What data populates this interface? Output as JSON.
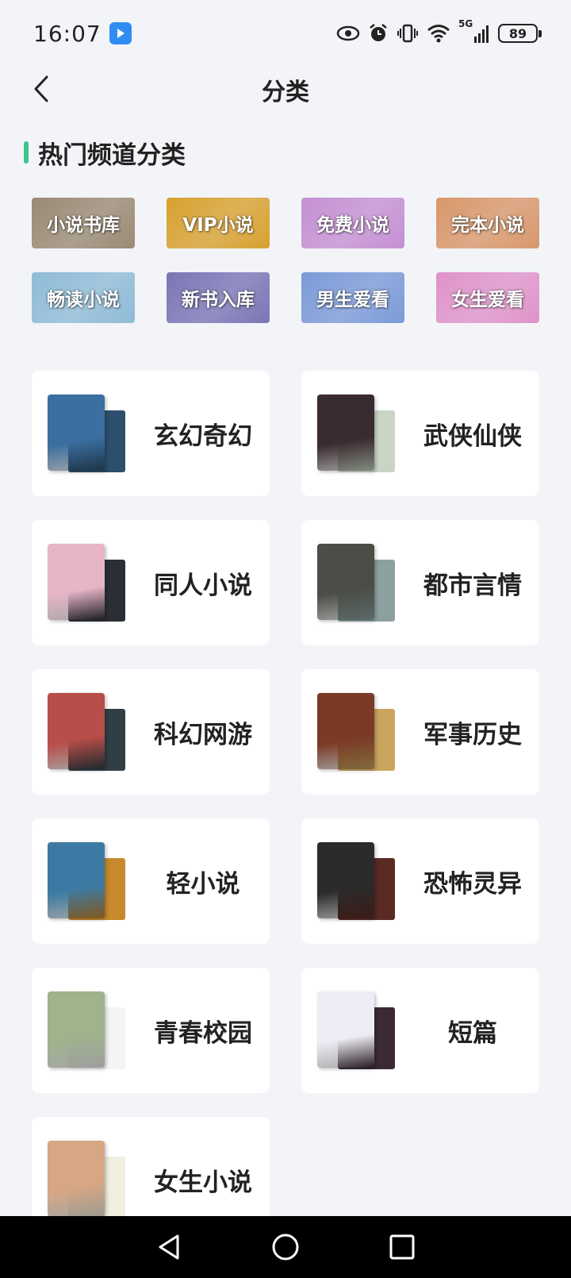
{
  "status_bar": {
    "time": "16:07",
    "network": "5G",
    "battery": "89",
    "icons": [
      "eye-icon",
      "alarm-icon",
      "vibrate-icon",
      "wifi-icon",
      "signal-icon",
      "battery-icon"
    ]
  },
  "header": {
    "back_icon": "chevron-left-icon",
    "title": "分类"
  },
  "hot_section": {
    "title": "热门频道分类",
    "accent": "#3fc48a",
    "tiles": [
      {
        "label": "小说书库",
        "color": "#9a8a74"
      },
      {
        "label": "VIP小说",
        "color": "#d7a12f"
      },
      {
        "label": "免费小说",
        "color": "#c58fd3"
      },
      {
        "label": "完本小说",
        "color": "#d8976b"
      },
      {
        "label": "畅读小说",
        "color": "#8fbbd7"
      },
      {
        "label": "新书入库",
        "color": "#7b75b5"
      },
      {
        "label": "男生爱看",
        "color": "#7b9ad8"
      },
      {
        "label": "女生爱看",
        "color": "#df93c9"
      }
    ]
  },
  "categories": [
    {
      "label": "玄幻奇幻",
      "cover_front": "#3b6fa0",
      "cover_back": "#2d4f6d"
    },
    {
      "label": "武侠仙侠",
      "cover_front": "#3a2b2f",
      "cover_back": "#c9d4c5"
    },
    {
      "label": "同人小说",
      "cover_front": "#e7b5c8",
      "cover_back": "#2b2f35"
    },
    {
      "label": "都市言情",
      "cover_front": "#4b4d46",
      "cover_back": "#8da0a0"
    },
    {
      "label": "科幻网游",
      "cover_front": "#b74e49",
      "cover_back": "#2f3f45"
    },
    {
      "label": "军事历史",
      "cover_front": "#7a3a25",
      "cover_back": "#c9a55d"
    },
    {
      "label": "轻小说",
      "cover_front": "#3d7aa3",
      "cover_back": "#c8892d"
    },
    {
      "label": "恐怖灵异",
      "cover_front": "#2c2b2b",
      "cover_back": "#5a2b25"
    },
    {
      "label": "青春校园",
      "cover_front": "#9fb38d",
      "cover_back": "#f4f3f5"
    },
    {
      "label": "短篇",
      "cover_front": "#eeecf4",
      "cover_back": "#3b2a35"
    },
    {
      "label": "女生小说",
      "cover_front": "#d7a783",
      "cover_back": "#f0efe0"
    }
  ],
  "nav_bar": {
    "icons": [
      "nav-back-icon",
      "nav-home-icon",
      "nav-recents-icon"
    ]
  }
}
